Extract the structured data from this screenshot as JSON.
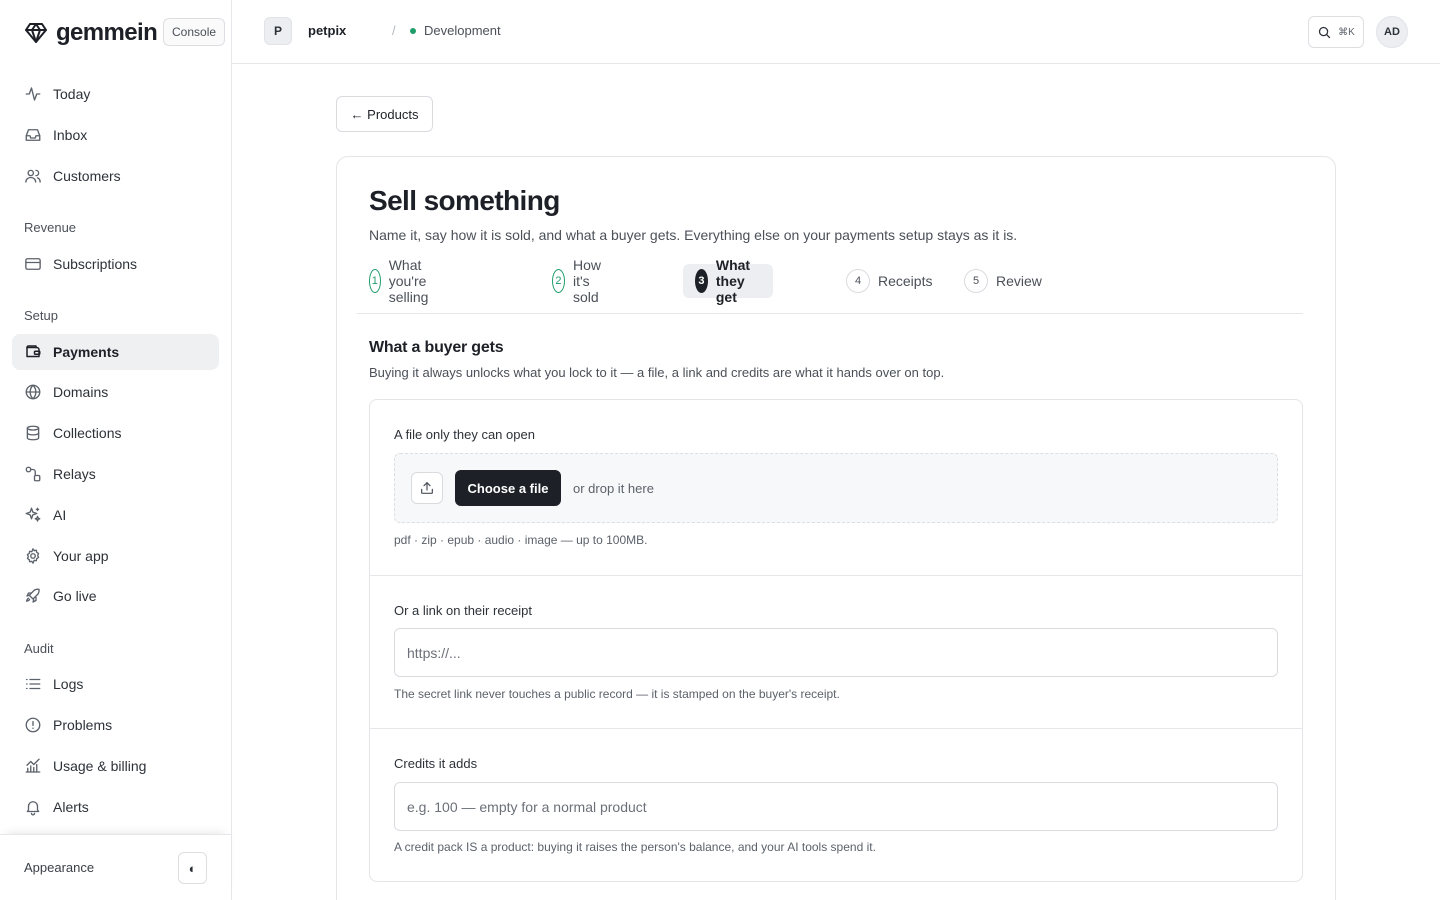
{
  "brand": {
    "name": "gemmein",
    "console_badge": "Console"
  },
  "sidebar": {
    "main": [
      {
        "label": "Today",
        "icon": "activity-icon"
      },
      {
        "label": "Inbox",
        "icon": "inbox-icon"
      },
      {
        "label": "Customers",
        "icon": "users-icon"
      }
    ],
    "revenue_label": "Revenue",
    "revenue": [
      {
        "label": "Subscriptions",
        "icon": "card-icon"
      }
    ],
    "setup_label": "Setup",
    "setup": [
      {
        "label": "Payments",
        "icon": "wallet-icon",
        "active": true
      },
      {
        "label": "Domains",
        "icon": "globe-icon"
      },
      {
        "label": "Collections",
        "icon": "database-icon"
      },
      {
        "label": "Relays",
        "icon": "relay-icon"
      },
      {
        "label": "AI",
        "icon": "sparkles-icon"
      },
      {
        "label": "Your app",
        "icon": "gear-icon"
      },
      {
        "label": "Go live",
        "icon": "rocket-icon"
      }
    ],
    "audit_label": "Audit",
    "audit": [
      {
        "label": "Logs",
        "icon": "list-icon"
      },
      {
        "label": "Problems",
        "icon": "alert-circle-icon"
      },
      {
        "label": "Usage & billing",
        "icon": "chart-icon"
      },
      {
        "label": "Alerts",
        "icon": "bell-icon"
      }
    ],
    "footer": {
      "appearance_label": "Appearance",
      "toggle_glyph": "◐"
    }
  },
  "topbar": {
    "project_initial": "P",
    "project_name": "petpix",
    "separator": "/",
    "environment": "Development",
    "environment_color": "#1f9d6b",
    "search_shortcut": "⌘K",
    "user_initials": "AD"
  },
  "main": {
    "back_label": "← Products",
    "title": "Sell something",
    "subtitle": "Name it, say how it is sold, and what a buyer gets. Everything else on your payments setup stays as it is.",
    "steps": [
      {
        "num": "1",
        "label": "What you're selling",
        "state": "done"
      },
      {
        "num": "2",
        "label": "How it's sold",
        "state": "done"
      },
      {
        "num": "3",
        "label": "What they get",
        "state": "current"
      },
      {
        "num": "4",
        "label": "Receipts",
        "state": "upcoming"
      },
      {
        "num": "5",
        "label": "Review",
        "state": "upcoming"
      }
    ],
    "section_title": "What a buyer gets",
    "section_desc": "Buying it always unlocks what you lock to it — a file, a link and credits are what it hands over on top.",
    "file": {
      "label": "A file only they can open",
      "choose_label": "Choose a file",
      "drop_hint": "or drop it here",
      "hint": "pdf · zip · epub · audio · image — up to 100MB."
    },
    "link": {
      "label": "Or a link on their receipt",
      "placeholder": "https://...",
      "hint": "The secret link never touches a public record — it is stamped on the buyer's receipt."
    },
    "credits": {
      "label": "Credits it adds",
      "placeholder": "e.g. 100 — empty for a normal product",
      "hint": "A credit pack IS a product: buying it raises the person's balance, and your AI tools spend it."
    }
  }
}
